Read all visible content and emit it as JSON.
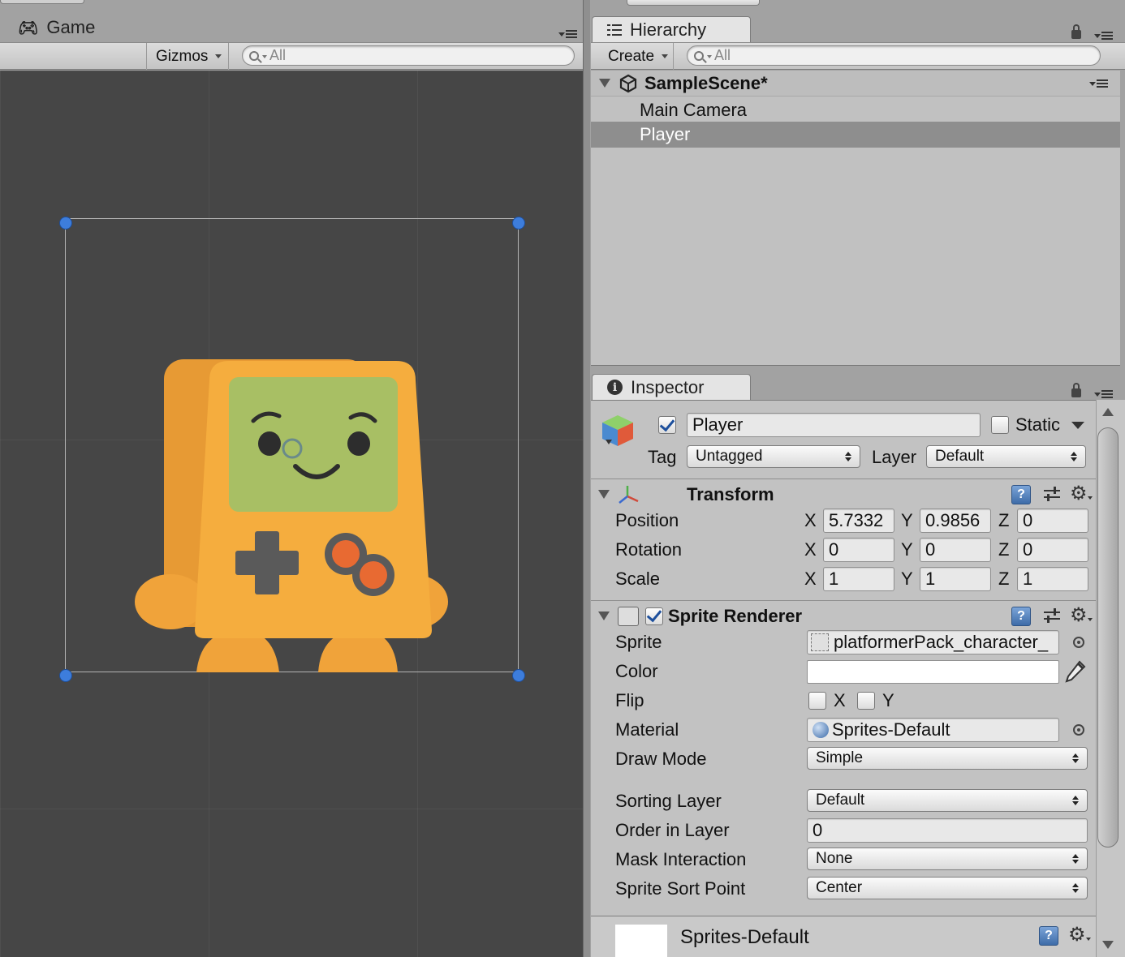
{
  "game": {
    "tab_label": "Game",
    "gizmos_label": "Gizmos",
    "search_placeholder": "All"
  },
  "hierarchy": {
    "tab_label": "Hierarchy",
    "create_label": "Create",
    "search_placeholder": "All",
    "scene_name": "SampleScene*",
    "items": [
      {
        "label": "Main Camera",
        "selected": false
      },
      {
        "label": "Player",
        "selected": true
      }
    ]
  },
  "inspector": {
    "tab_label": "Inspector",
    "object_name": "Player",
    "active": true,
    "static_label": "Static",
    "static_checked": false,
    "tag_label": "Tag",
    "tag_value": "Untagged",
    "layer_label": "Layer",
    "layer_value": "Default",
    "transform": {
      "title": "Transform",
      "position_label": "Position",
      "rotation_label": "Rotation",
      "scale_label": "Scale",
      "axis_x": "X",
      "axis_y": "Y",
      "axis_z": "Z",
      "position": {
        "x": "5.7332",
        "y": "0.9856",
        "z": "0"
      },
      "rotation": {
        "x": "0",
        "y": "0",
        "z": "0"
      },
      "scale": {
        "x": "1",
        "y": "1",
        "z": "1"
      }
    },
    "sprite_renderer": {
      "title": "Sprite Renderer",
      "enabled": true,
      "sprite_label": "Sprite",
      "sprite_value": "platformerPack_character_",
      "color_label": "Color",
      "color_value": "#ffffff",
      "flip_label": "Flip",
      "flip_x_label": "X",
      "flip_y_label": "Y",
      "flip_x": false,
      "flip_y": false,
      "material_label": "Material",
      "material_value": "Sprites-Default",
      "draw_mode_label": "Draw Mode",
      "draw_mode_value": "Simple",
      "sorting_layer_label": "Sorting Layer",
      "sorting_layer_value": "Default",
      "order_label": "Order in Layer",
      "order_value": "0",
      "mask_label": "Mask Interaction",
      "mask_value": "None",
      "sort_point_label": "Sprite Sort Point",
      "sort_point_value": "Center"
    },
    "material_asset": {
      "title": "Sprites-Default"
    }
  },
  "colors": {
    "game_background": "#464646",
    "panel_background": "#c2c2c2",
    "selection": "#8e8e8e",
    "character_body": "#f0a33a",
    "character_screen": "#a8bf64",
    "character_buttons": "#e86a32",
    "handle": "#3d7ddc"
  }
}
